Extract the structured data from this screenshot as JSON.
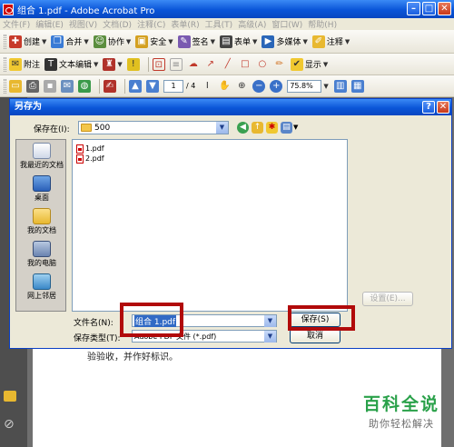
{
  "window": {
    "title": "组合 1.pdf - Adobe Acrobat Pro"
  },
  "menu": [
    "文件(F)",
    "编辑(E)",
    "视图(V)",
    "文档(D)",
    "注释(C)",
    "表单(R)",
    "工具(T)",
    "高级(A)",
    "窗口(W)",
    "帮助(H)"
  ],
  "toolbar1": {
    "create": "创建",
    "combine": "合并",
    "collaborate": "协作",
    "secure": "安全",
    "sign": "签名",
    "forms": "表单",
    "multimedia": "多媒体",
    "comment": "注释"
  },
  "toolbar2": {
    "sticky_note": "附注",
    "text_edit": "文本编辑",
    "show": "显示"
  },
  "toolbar3": {
    "page_current": "1",
    "page_total": "/ 4",
    "zoom": "75.8%"
  },
  "document": {
    "text": "验验收，并作好标识。"
  },
  "dialog": {
    "title": "另存为",
    "look_in_label": "保存在(I):",
    "look_in_value": "500",
    "places": [
      {
        "label": "我最近的文档",
        "icon": "recent-docs-icon"
      },
      {
        "label": "桌面",
        "icon": "desktop-icon"
      },
      {
        "label": "我的文档",
        "icon": "my-documents-icon"
      },
      {
        "label": "我的电脑",
        "icon": "my-computer-icon"
      },
      {
        "label": "网上邻居",
        "icon": "network-icon"
      }
    ],
    "files": [
      "1.pdf",
      "2.pdf"
    ],
    "filename_label": "文件名(N):",
    "filename_value": "组合 1.pdf",
    "filetype_label": "保存类型(T):",
    "filetype_value": "Adobe PDF 文件 (*.pdf)",
    "settings_button": "设置(E)...",
    "save_button": "保存(S)",
    "cancel_button": "取消"
  },
  "watermark": {
    "title": "百科全说",
    "subtitle": "助你轻松解决"
  },
  "colors": {
    "titlebar": "#0a55d8",
    "highlight": "#b10a0a",
    "watermark": "#2aa14a"
  }
}
